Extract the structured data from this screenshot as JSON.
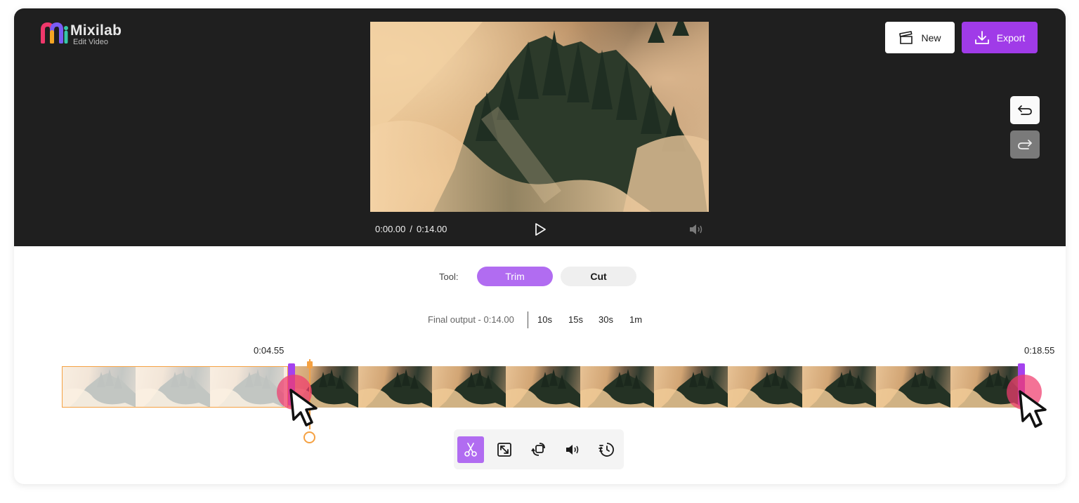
{
  "app": {
    "name": "Mixilab",
    "subtitle": "Edit Video",
    "accent_color": "#a03be8"
  },
  "header": {
    "new_label": "New",
    "new_icon": "clapperboard-icon",
    "export_label": "Export",
    "export_icon": "download-icon"
  },
  "history": {
    "undo_icon": "undo-icon",
    "redo_icon": "redo-icon"
  },
  "player": {
    "current_time": "0:00.00",
    "separator": "/",
    "total_time": "0:14.00",
    "play_icon": "play-icon",
    "volume_icon": "volume-icon"
  },
  "tools": {
    "label": "Tool:",
    "options": [
      "Trim",
      "Cut"
    ],
    "selected": "Trim"
  },
  "output": {
    "label": "Final output - 0:14.00",
    "durations": [
      "10s",
      "15s",
      "30s",
      "1m"
    ]
  },
  "timeline": {
    "trim_start": "0:04.55",
    "trim_end": "0:18.55",
    "frame_count": 13
  },
  "bottom_toolbar": {
    "icons": [
      "scissors-icon",
      "resize-icon",
      "rotate-icon",
      "volume-icon",
      "speed-icon"
    ],
    "active": "scissors-icon"
  }
}
